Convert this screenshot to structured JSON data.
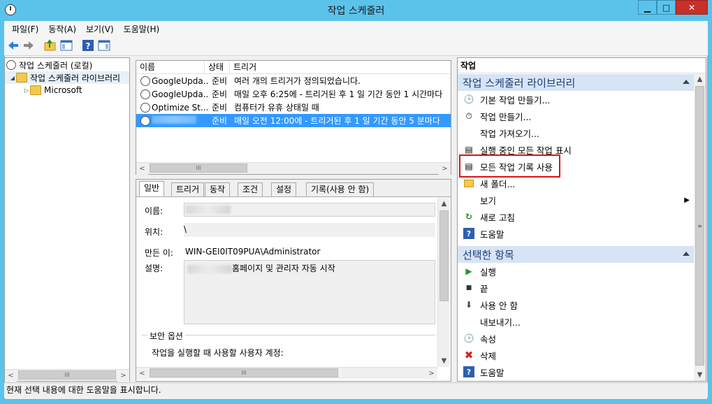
{
  "window": {
    "title": "작업 스케줄러",
    "min_label": "▁",
    "max_label": "□",
    "close_label": "✕"
  },
  "menu": [
    "파일(F)",
    "동작(A)",
    "보기(V)",
    "도움말(H)"
  ],
  "tree": {
    "root": "작업 스케줄러 (로컬)",
    "library": "작업 스케줄러 라이브러리",
    "microsoft": "Microsoft"
  },
  "task_list": {
    "columns": [
      "이름",
      "상태",
      "트리거"
    ],
    "rows": [
      {
        "name": "GoogleUpda...",
        "status": "준비",
        "trigger": "여러 개의 트리거가 정의되었습니다."
      },
      {
        "name": "GoogleUpda...",
        "status": "준비",
        "trigger": "매일 오후 6:25에 - 트리거된 후 1 일 기간 동안 1 시간마다"
      },
      {
        "name": "Optimize St...",
        "status": "준비",
        "trigger": "컴퓨터가 유휴 상태일 때"
      },
      {
        "name": "",
        "status": "준비",
        "trigger": "매일 오전 12:00에 - 트리거된 후 1 일 기간 동안 5 분마다"
      }
    ]
  },
  "tabs": [
    "일반",
    "트리거",
    "동작",
    "조건",
    "설정",
    "기록(사용 안 함)"
  ],
  "general": {
    "name_label": "이름:",
    "location_label": "위치:",
    "location_value": "\\",
    "author_label": "만든 이:",
    "author_value": "WIN-GEI0IT09PUA\\Administrator",
    "desc_label": "설명:",
    "desc_value": "홈페이지 및 관리자 자동 시작",
    "security_label": "보안 옵션",
    "security_desc": "작업을 실행할 때 사용할 사용자 계정:"
  },
  "actions": {
    "header": "작업",
    "section1": "작업 스케줄러 라이브러리",
    "section1_items": [
      "기본 작업 만들기...",
      "작업 만들기...",
      "작업 가져오기...",
      "실행 중인 모든 작업 표시",
      "모든 작업 기록 사용",
      "새 폴더...",
      "보기",
      "새로 고침",
      "도움말"
    ],
    "section2": "선택한 항목",
    "section2_items": [
      "실행",
      "끝",
      "사용 안 함",
      "내보내기...",
      "속성",
      "삭제",
      "도움말"
    ]
  },
  "status": "현재 선택 내용에 대한 도움말을 표시합니다.",
  "colors": {
    "accent": "#5bc3ea",
    "selection": "#3399ff",
    "highlight_box": "#e01010"
  }
}
